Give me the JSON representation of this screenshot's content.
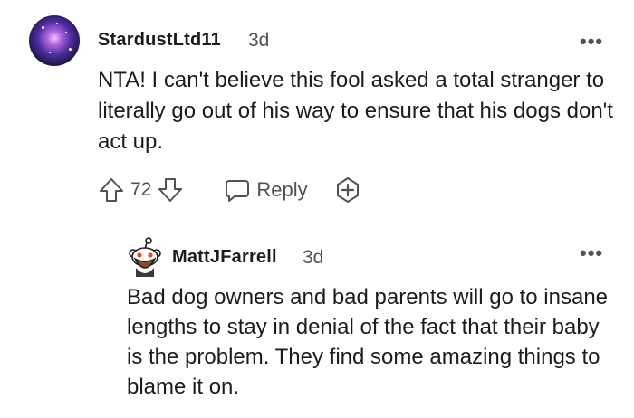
{
  "comment": {
    "username": "StardustLtd11",
    "time": "3d",
    "more": "•••",
    "body": "NTA! I can't believe this fool asked a total stranger to literally go out of his way to ensure that his dogs don't act up.",
    "upvotes": "72",
    "reply_label": "Reply"
  },
  "reply": {
    "username": "MattJFarrell",
    "time": "3d",
    "more": "•••",
    "body": "Bad dog owners and bad parents will go to insane lengths to stay in denial of the fact that their baby is the problem. They find some amazing things to blame it on."
  },
  "icons": {
    "upvote": "upvote-arrow-icon",
    "downvote": "downvote-arrow-icon",
    "reply": "speech-bubble-icon",
    "award": "plus-badge-icon"
  },
  "colors": {
    "text": "#1c1c1c",
    "meta": "#4f5256",
    "threadline": "#e6e6e6"
  }
}
